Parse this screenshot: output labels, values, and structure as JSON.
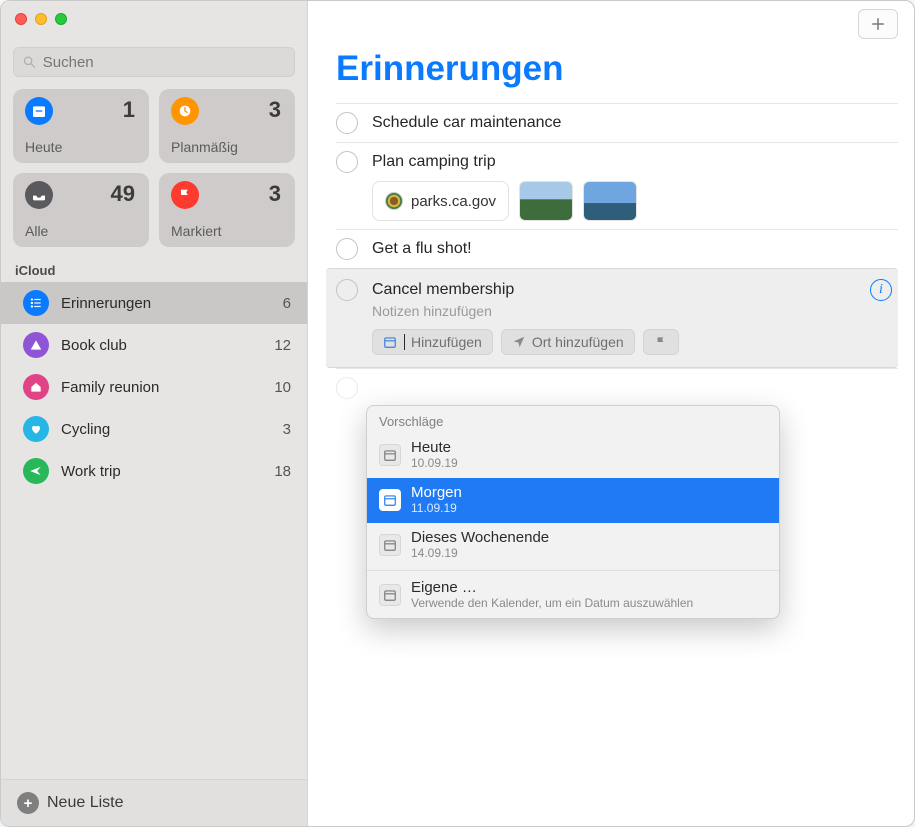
{
  "search": {
    "placeholder": "Suchen"
  },
  "smart_cards": {
    "today": {
      "label": "Heute",
      "count": "1"
    },
    "scheduled": {
      "label": "Planmäßig",
      "count": "3"
    },
    "all": {
      "label": "Alle",
      "count": "49"
    },
    "flagged": {
      "label": "Markiert",
      "count": "3"
    }
  },
  "section_header": "iCloud",
  "lists": [
    {
      "name": "Erinnerungen",
      "count": "6",
      "color": "#0a7bff",
      "icon": "list"
    },
    {
      "name": "Book club",
      "count": "12",
      "color": "#8e56d6",
      "icon": "tent"
    },
    {
      "name": "Family reunion",
      "count": "10",
      "color": "#e04486",
      "icon": "house"
    },
    {
      "name": "Cycling",
      "count": "3",
      "color": "#25b6e6",
      "icon": "heart"
    },
    {
      "name": "Work trip",
      "count": "18",
      "color": "#28b859",
      "icon": "plane"
    }
  ],
  "new_list_label": "Neue Liste",
  "main": {
    "title": "Erinnerungen",
    "items": {
      "i0": {
        "title": "Schedule car maintenance"
      },
      "i1": {
        "title": "Plan camping trip",
        "link": "parks.ca.gov"
      },
      "i2": {
        "title": "Get a flu shot!"
      },
      "i3": {
        "title": "Cancel membership",
        "notes_placeholder": "Notizen hinzufügen",
        "pill_date": "Hinzufügen",
        "pill_location": "Ort hinzufügen"
      }
    }
  },
  "popover": {
    "header": "Vorschläge",
    "s0": {
      "title": "Heute",
      "sub": "10.09.19"
    },
    "s1": {
      "title": "Morgen",
      "sub": "11.09.19"
    },
    "s2": {
      "title": "Dieses Wochenende",
      "sub": "14.09.19"
    },
    "s3": {
      "title": "Eigene …",
      "sub": "Verwende den Kalender, um ein Datum auszuwählen"
    }
  }
}
